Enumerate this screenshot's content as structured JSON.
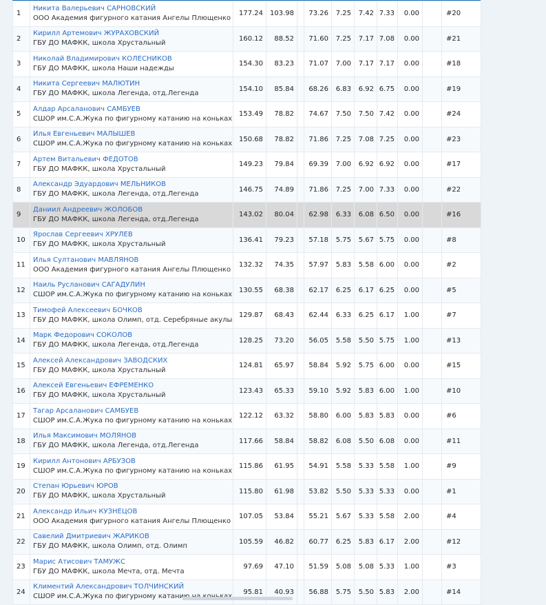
{
  "rows": [
    {
      "place": "1",
      "name": "Никита Валерьевич САРНОВСКИЙ",
      "club": "ООО Академия фигурного катания Ангелы Плющенко",
      "total": "177.24",
      "tes": "103.98",
      "pcs": "73.26",
      "c1": "7.25",
      "c2": "7.42",
      "c3": "7.33",
      "ded": "0.00",
      "start": "#20"
    },
    {
      "place": "2",
      "name": "Кирилл Артемович ЖУРАХОВСКИЙ",
      "club": "ГБУ ДО МАФКК, школа Хрустальный",
      "total": "160.12",
      "tes": "88.52",
      "pcs": "71.60",
      "c1": "7.25",
      "c2": "7.17",
      "c3": "7.08",
      "ded": "0.00",
      "start": "#21"
    },
    {
      "place": "3",
      "name": "Николай Владимирович КОЛЕСНИКОВ",
      "club": "ГБУ ДО МАФКК, школа Наши надежды",
      "total": "154.30",
      "tes": "83.23",
      "pcs": "71.07",
      "c1": "7.00",
      "c2": "7.17",
      "c3": "7.17",
      "ded": "0.00",
      "start": "#18"
    },
    {
      "place": "4",
      "name": "Никита Сергеевич МАЛЮТИН",
      "club": "ГБУ ДО МАФКК, школа Легенда, отд.Легенда",
      "total": "154.10",
      "tes": "85.84",
      "pcs": "68.26",
      "c1": "6.83",
      "c2": "6.92",
      "c3": "6.75",
      "ded": "0.00",
      "start": "#19"
    },
    {
      "place": "5",
      "name": "Алдар Арсаланович САМБУЕВ",
      "club": "СШОР им.С.А.Жука по фигурному катанию на коньках",
      "total": "153.49",
      "tes": "78.82",
      "pcs": "74.67",
      "c1": "7.50",
      "c2": "7.50",
      "c3": "7.42",
      "ded": "0.00",
      "start": "#24"
    },
    {
      "place": "6",
      "name": "Илья Евгеньевич МАЛЫШЕВ",
      "club": "СШОР им.С.А.Жука по фигурному катанию на коньках",
      "total": "150.68",
      "tes": "78.82",
      "pcs": "71.86",
      "c1": "7.25",
      "c2": "7.08",
      "c3": "7.25",
      "ded": "0.00",
      "start": "#23"
    },
    {
      "place": "7",
      "name": "Артем Витальевич ФЕДОТОВ",
      "club": "ГБУ ДО МАФКК, школа Хрустальный",
      "total": "149.23",
      "tes": "79.84",
      "pcs": "69.39",
      "c1": "7.00",
      "c2": "6.92",
      "c3": "6.92",
      "ded": "0.00",
      "start": "#17"
    },
    {
      "place": "8",
      "name": "Александр Эдуардович МЕЛЬНИКОВ",
      "club": "ГБУ ДО МАФКК, школа Легенда, отд.Легенда",
      "total": "146.75",
      "tes": "74.89",
      "pcs": "71.86",
      "c1": "7.25",
      "c2": "7.00",
      "c3": "7.33",
      "ded": "0.00",
      "start": "#22"
    },
    {
      "place": "9",
      "name": "Даниил Андреевич ЖОЛОБОВ",
      "club": "ГБУ ДО МАФКК, школа Легенда, отд.Легенда",
      "total": "143.02",
      "tes": "80.04",
      "pcs": "62.98",
      "c1": "6.33",
      "c2": "6.08",
      "c3": "6.50",
      "ded": "0.00",
      "start": "#16",
      "highlight": true
    },
    {
      "place": "10",
      "name": "Ярослав Сергеевич ХРУЛЕВ",
      "club": "ГБУ ДО МАФКК, школа Хрустальный",
      "total": "136.41",
      "tes": "79.23",
      "pcs": "57.18",
      "c1": "5.75",
      "c2": "5.67",
      "c3": "5.75",
      "ded": "0.00",
      "start": "#8"
    },
    {
      "place": "11",
      "name": "Илья Султанович МАВЛЯНОВ",
      "club": "ООО Академия фигурного катания Ангелы Плющенко",
      "total": "132.32",
      "tes": "74.35",
      "pcs": "57.97",
      "c1": "5.83",
      "c2": "5.58",
      "c3": "6.00",
      "ded": "0.00",
      "start": "#2"
    },
    {
      "place": "12",
      "name": "Наиль Русланович САГАДУЛИН",
      "club": "СШОР им.С.А.Жука по фигурному катанию на коньках",
      "total": "130.55",
      "tes": "68.38",
      "pcs": "62.17",
      "c1": "6.25",
      "c2": "6.17",
      "c3": "6.25",
      "ded": "0.00",
      "start": "#5"
    },
    {
      "place": "13",
      "name": "Тимофей Алексеевич БОЧКОВ",
      "club": "ГБУ ДО МАФКК, школа Олимп, отд. Серебряные акулы",
      "total": "129.87",
      "tes": "68.43",
      "pcs": "62.44",
      "c1": "6.33",
      "c2": "6.25",
      "c3": "6.17",
      "ded": "1.00",
      "start": "#7"
    },
    {
      "place": "14",
      "name": "Марк Федорович СОКОЛОВ",
      "club": "ГБУ ДО МАФКК, школа Легенда, отд.Легенда",
      "total": "128.25",
      "tes": "73.20",
      "pcs": "56.05",
      "c1": "5.58",
      "c2": "5.50",
      "c3": "5.75",
      "ded": "1.00",
      "start": "#13"
    },
    {
      "place": "15",
      "name": "Алексей Александрович ЗАВОДСКИХ",
      "club": "ГБУ ДО МАФКК, школа Хрустальный",
      "total": "124.81",
      "tes": "65.97",
      "pcs": "58.84",
      "c1": "5.92",
      "c2": "5.75",
      "c3": "6.00",
      "ded": "0.00",
      "start": "#15"
    },
    {
      "place": "16",
      "name": "Алексей Евгеньевич ЕФРЕМЕНКО",
      "club": "ГБУ ДО МАФКК, школа Хрустальный",
      "total": "123.43",
      "tes": "65.33",
      "pcs": "59.10",
      "c1": "5.92",
      "c2": "5.83",
      "c3": "6.00",
      "ded": "1.00",
      "start": "#10"
    },
    {
      "place": "17",
      "name": "Тагар Арсаланович САМБУЕВ",
      "club": "СШОР им.С.А.Жука по фигурному катанию на коньках",
      "total": "122.12",
      "tes": "63.32",
      "pcs": "58.80",
      "c1": "6.00",
      "c2": "5.83",
      "c3": "5.83",
      "ded": "0.00",
      "start": "#6"
    },
    {
      "place": "18",
      "name": "Илья Максимович МОЛЯНОВ",
      "club": "ГБУ ДО МАФКК, школа Легенда, отд.Легенда",
      "total": "117.66",
      "tes": "58.84",
      "pcs": "58.82",
      "c1": "6.08",
      "c2": "5.50",
      "c3": "6.08",
      "ded": "0.00",
      "start": "#11"
    },
    {
      "place": "19",
      "name": "Кирилл Антонович АРБУЗОВ",
      "club": "СШОР им.С.А.Жука по фигурному катанию на коньках",
      "total": "115.86",
      "tes": "61.95",
      "pcs": "54.91",
      "c1": "5.58",
      "c2": "5.33",
      "c3": "5.58",
      "ded": "1.00",
      "start": "#9"
    },
    {
      "place": "20",
      "name": "Степан Юрьевич ЮРОВ",
      "club": "ГБУ ДО МАФКК, школа Хрустальный",
      "total": "115.80",
      "tes": "61.98",
      "pcs": "53.82",
      "c1": "5.50",
      "c2": "5.33",
      "c3": "5.33",
      "ded": "0.00",
      "start": "#1"
    },
    {
      "place": "21",
      "name": "Александр Ильич КУЗНЕЦОВ",
      "club": "ООО Академия фигурного катания Ангелы Плющенко",
      "total": "107.05",
      "tes": "53.84",
      "pcs": "55.21",
      "c1": "5.67",
      "c2": "5.33",
      "c3": "5.58",
      "ded": "2.00",
      "start": "#4"
    },
    {
      "place": "22",
      "name": "Савелий Дмитриевич ЖАРИКОВ",
      "club": "ГБУ ДО МАФКК, школа Олимп, отд. Олимп",
      "total": "105.59",
      "tes": "46.82",
      "pcs": "60.77",
      "c1": "6.25",
      "c2": "5.83",
      "c3": "6.17",
      "ded": "2.00",
      "start": "#12"
    },
    {
      "place": "23",
      "name": "Марис Атисович ТАМУЖС",
      "club": "ГБУ ДО МАФКК, школа Мечта, отд. Мечта",
      "total": "97.69",
      "tes": "47.10",
      "pcs": "51.59",
      "c1": "5.08",
      "c2": "5.08",
      "c3": "5.33",
      "ded": "1.00",
      "start": "#3"
    },
    {
      "place": "24",
      "name": "Климентий Александрович ТОЛЧИНСКИЙ",
      "club": "СШОР им.С.А.Жука по фигурному катанию на коньках",
      "total": "95.81",
      "tes": "40.93",
      "pcs": "56.88",
      "c1": "5.75",
      "c2": "5.50",
      "c3": "5.83",
      "ded": "2.00",
      "start": "#14"
    }
  ]
}
